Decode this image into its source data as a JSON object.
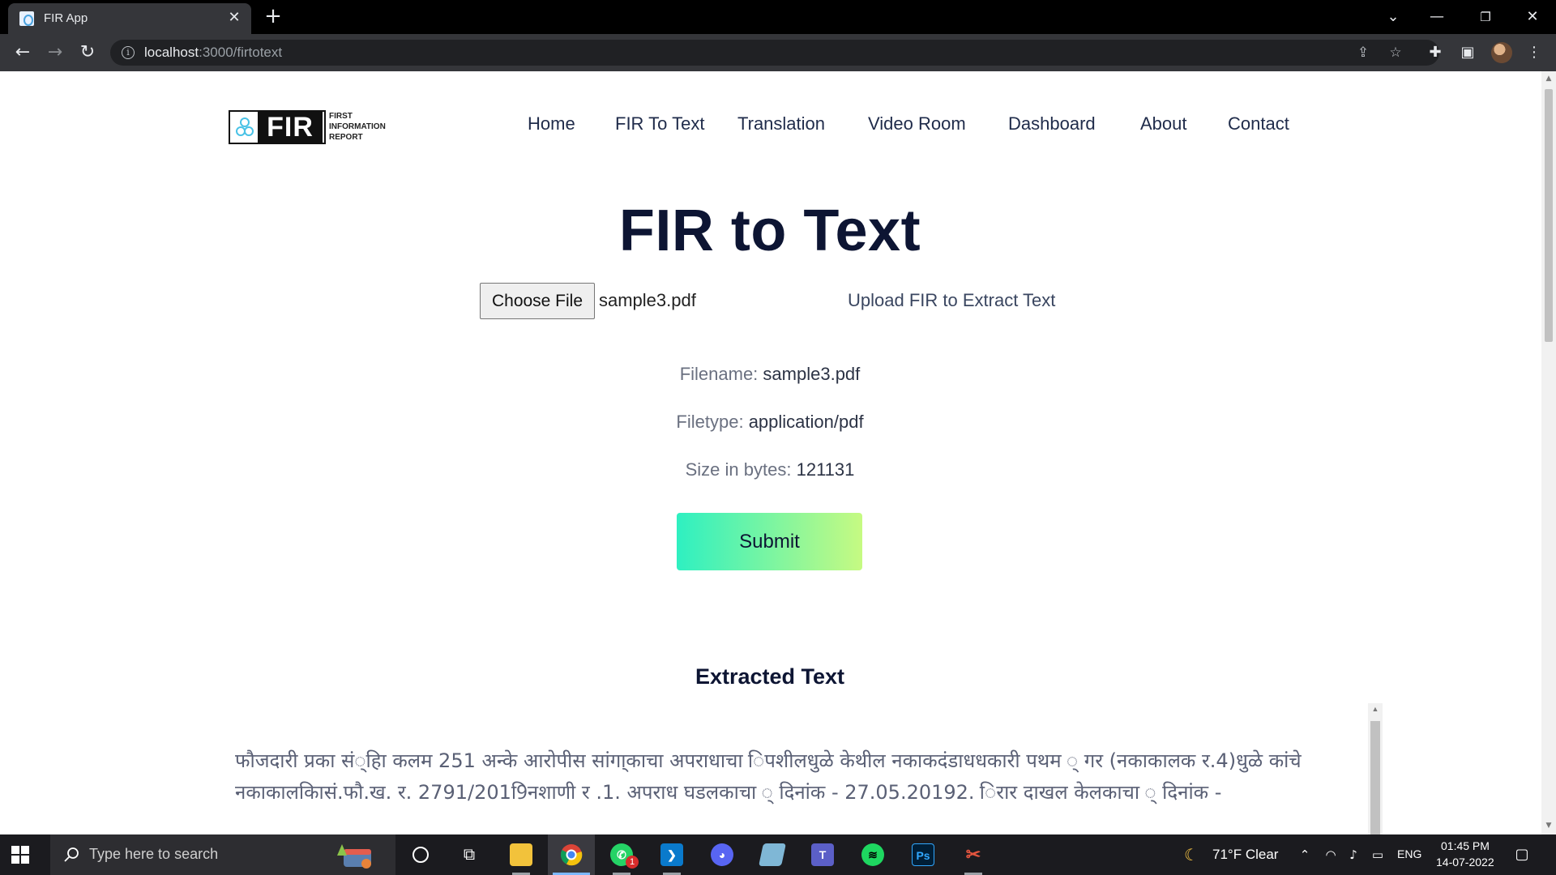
{
  "browser": {
    "tab_title": "FIR App",
    "tab_close": "✕",
    "new_tab": "+",
    "url_host": "localhost",
    "url_path": ":3000/firtotext"
  },
  "site": {
    "logo": {
      "text": "FIR",
      "subtitle_line1": "FIRST",
      "subtitle_line2": "INFORMATION",
      "subtitle_line3": "REPORT"
    },
    "nav": [
      {
        "label": "Home"
      },
      {
        "label": "FIR To Text"
      },
      {
        "label": "Translation"
      },
      {
        "label": "Video Room"
      },
      {
        "label": "Dashboard"
      },
      {
        "label": "About"
      },
      {
        "label": "Contact"
      }
    ]
  },
  "main": {
    "title": "FIR to Text",
    "choose_file_label": "Choose File",
    "selected_file": "sample3.pdf",
    "upload_hint": "Upload FIR to Extract Text",
    "filename_label": "Filename:",
    "filename_value": "sample3.pdf",
    "filetype_label": "Filetype:",
    "filetype_value": "application/pdf",
    "size_label": "Size in bytes:",
    "size_value": "121131",
    "submit_label": "Submit",
    "extracted_heading": "Extracted Text",
    "extracted_text": "फौजदारी प्रका सं्हिा कलम 251 अन्के आरोपीस सांगा्काचा अपराधाचा िपशीलधुळे केथील नकाकदंडाधधकारी पथम ् गर (नकाकालक र.4)धुळे कांचे नकाकालकिासं.फौ.ख. र. 2791/2019िनशाणी र .1. अपराध घडलकाचा ् दिनांक - 27.05.20192. िरार दाखल केलकाचा ् दिनांक -"
  },
  "taskbar": {
    "search_placeholder": "Type here to search",
    "whatsapp_badge": "1",
    "weather": "71°F  Clear",
    "language": "ENG",
    "time": "01:45 PM",
    "date": "14-07-2022",
    "app_icons": [
      "cortana-icon",
      "task-view-icon",
      "file-explorer-icon",
      "chrome-icon",
      "whatsapp-icon",
      "vscode-icon",
      "discord-icon",
      "notes-icon",
      "teams-icon",
      "spotify-icon",
      "photoshop-icon",
      "snipping-tool-icon"
    ]
  }
}
